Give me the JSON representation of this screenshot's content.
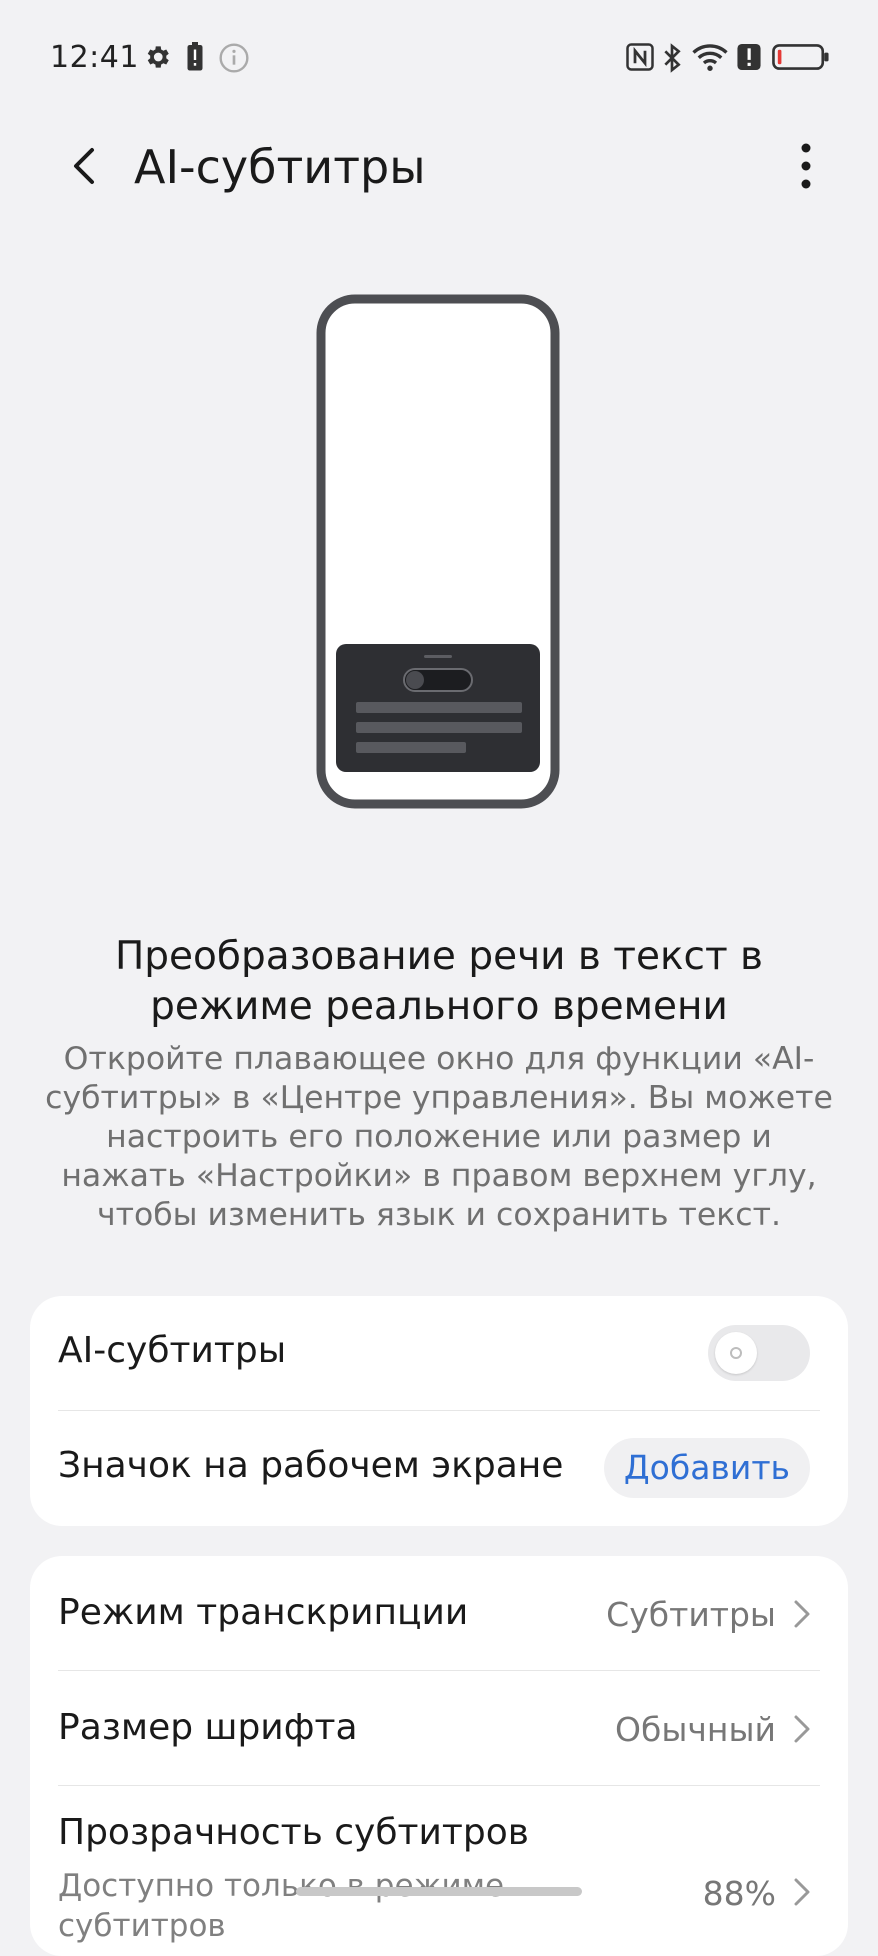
{
  "status_bar": {
    "time": "12:41",
    "icons": [
      "settings-gear-icon",
      "battery-alert-icon",
      "info-icon",
      "nfc-icon",
      "bluetooth-icon",
      "wifi-icon",
      "alert-icon",
      "battery-low-icon"
    ]
  },
  "app_bar": {
    "title": "AI-субтитры",
    "back_icon": "chevron-left-icon",
    "more_icon": "vertical-dots-icon"
  },
  "intro": {
    "headline": "Преобразование речи в текст в режиме реального времени",
    "description": "Откройте плавающее окно для функции «AI-субтитры» в «Центре управления». Вы можете настроить его положение или размер и нажать «Настройки» в правом верхнем углу, чтобы изменить язык и сохранить текст."
  },
  "card1": {
    "ai_subtitles_label": "AI-субтитры",
    "ai_subtitles_enabled": false,
    "home_icon_label": "Значок на рабочем экране",
    "add_button": "Добавить"
  },
  "card2": {
    "transcription_mode_label": "Режим транскрипции",
    "transcription_mode_value": "Субтитры",
    "font_size_label": "Размер шрифта",
    "font_size_value": "Обычный",
    "transparency_label": "Прозрачность субтитров",
    "transparency_sub": "Доступно только в режиме субтитров",
    "transparency_value": "88%"
  },
  "colors": {
    "background": "#f2f2f4",
    "card": "#ffffff",
    "accent": "#2f6fd4",
    "battery_low": "#e53935"
  }
}
